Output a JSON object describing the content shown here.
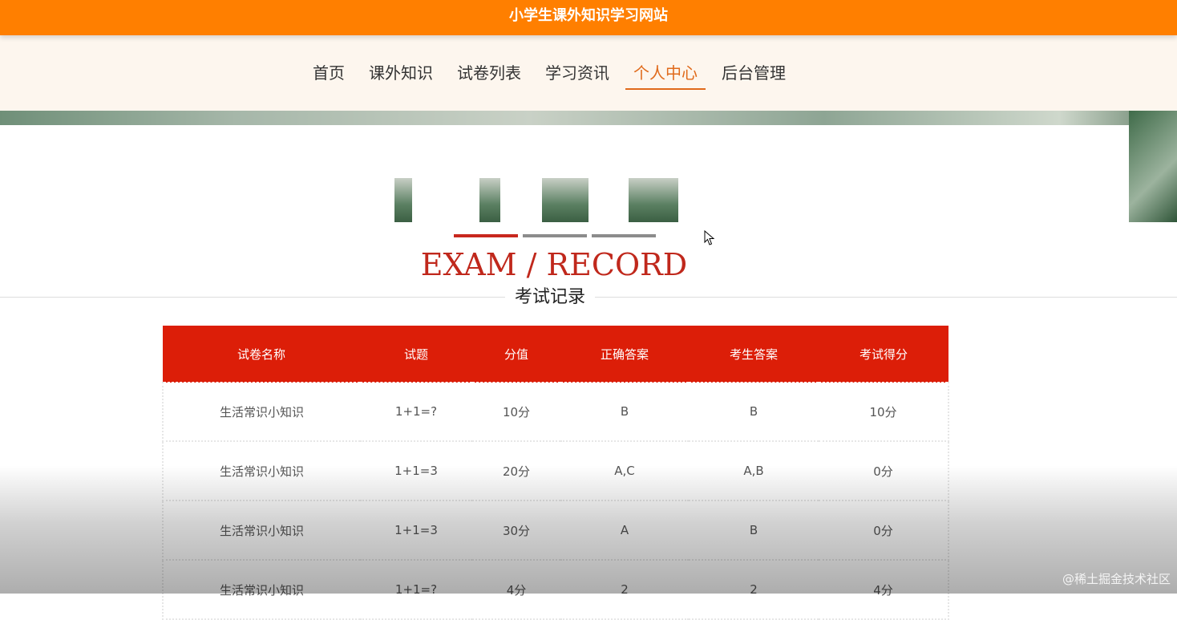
{
  "site": {
    "title": "小学生课外知识学习网站"
  },
  "nav": {
    "items": [
      "首页",
      "课外知识",
      "试卷列表",
      "学习资讯",
      "个人中心",
      "后台管理"
    ],
    "active": "个人中心"
  },
  "section": {
    "title_en": "EXAM / RECORD",
    "title_cn": "考试记录"
  },
  "table": {
    "headers": [
      "试卷名称",
      "试题",
      "分值",
      "正确答案",
      "考生答案",
      "考试得分"
    ],
    "rows": [
      [
        "生活常识小知识",
        "1+1=?",
        "10分",
        "B",
        "B",
        "10分"
      ],
      [
        "生活常识小知识",
        "1+1=3",
        "20分",
        "A,C",
        "A,B",
        "0分"
      ],
      [
        "生活常识小知识",
        "1+1=3",
        "30分",
        "A",
        "B",
        "0分"
      ],
      [
        "生活常识小知识",
        "1+1=?",
        "4分",
        "2",
        "2",
        "4分"
      ]
    ]
  },
  "watermark": "@稀土掘金技术社区",
  "colors": {
    "topbar": "#ff7f00",
    "nav_active": "#e06a1b",
    "table_header": "#dc1e08",
    "title_en": "#c0281c"
  },
  "icons": {
    "cursor": "mouse-pointer-icon"
  }
}
